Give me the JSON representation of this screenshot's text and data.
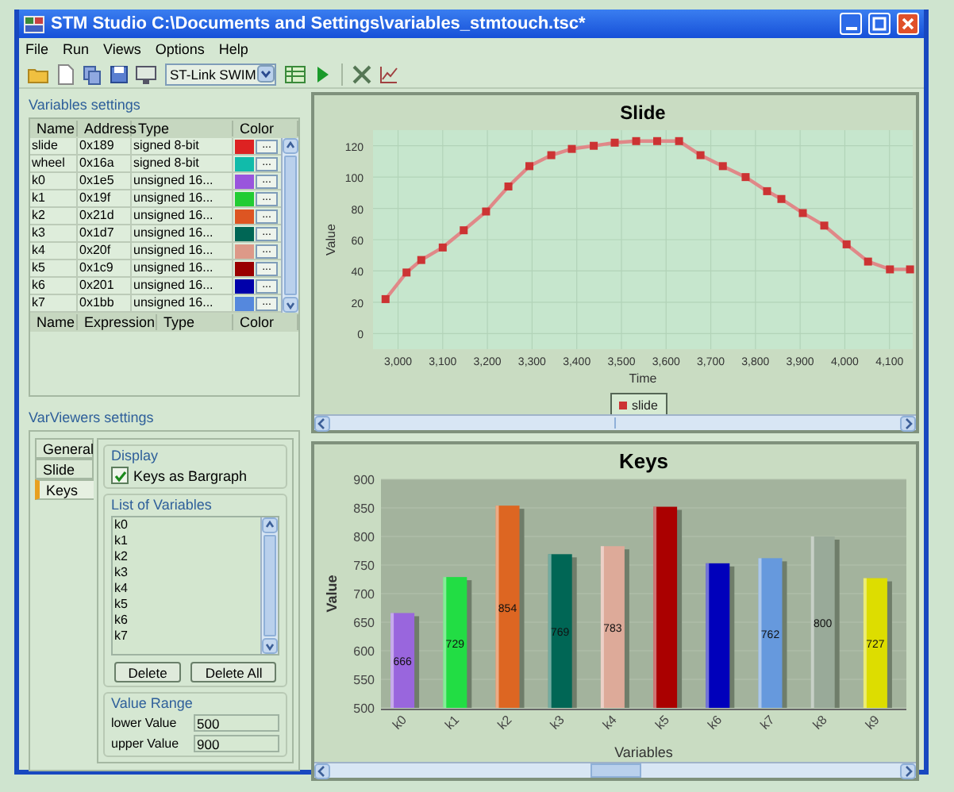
{
  "window": {
    "title": "STM Studio C:\\Documents and Settings\\variables_stmtouch.tsc*"
  },
  "menu": [
    "File",
    "Run",
    "Views",
    "Options",
    "Help"
  ],
  "toolbar": {
    "connection": "ST-Link SWIM"
  },
  "variables_settings": {
    "title": "Variables settings",
    "columns": [
      "Name",
      "Address",
      "Type",
      "Color"
    ],
    "rows": [
      {
        "name": "slide",
        "address": "0x189",
        "type": "signed 8-bit",
        "color": "#dd2222",
        "picker": "..."
      },
      {
        "name": "wheel",
        "address": "0x16a",
        "type": "signed 8-bit",
        "color": "#11bbaa",
        "picker": "..."
      },
      {
        "name": "k0",
        "address": "0x1e5",
        "type": "unsigned 16...",
        "color": "#9955dd",
        "picker": "..."
      },
      {
        "name": "k1",
        "address": "0x19f",
        "type": "unsigned 16...",
        "color": "#22cc33",
        "picker": "..."
      },
      {
        "name": "k2",
        "address": "0x21d",
        "type": "unsigned 16...",
        "color": "#dd5522",
        "picker": "..."
      },
      {
        "name": "k3",
        "address": "0x1d7",
        "type": "unsigned 16...",
        "color": "#006655",
        "picker": "..."
      },
      {
        "name": "k4",
        "address": "0x20f",
        "type": "unsigned 16...",
        "color": "#dd9988",
        "picker": "..."
      },
      {
        "name": "k5",
        "address": "0x1c9",
        "type": "unsigned 16...",
        "color": "#990000",
        "picker": "..."
      },
      {
        "name": "k6",
        "address": "0x201",
        "type": "unsigned 16...",
        "color": "#0000aa",
        "picker": "..."
      },
      {
        "name": "k7",
        "address": "0x1bb",
        "type": "unsigned 16...",
        "color": "#5588dd",
        "picker": "..."
      }
    ],
    "expressions": {
      "columns": [
        "Name",
        "Expression",
        "Type",
        "Color"
      ]
    }
  },
  "viewers_settings": {
    "title": "VarViewers settings",
    "tabs": [
      {
        "label": "General",
        "selected": false
      },
      {
        "label": "Slide",
        "selected": false
      },
      {
        "label": "Keys",
        "selected": true
      }
    ],
    "display": {
      "title": "Display",
      "bargraph": {
        "label": "Keys as Bargraph",
        "checked": true
      }
    },
    "list": {
      "title": "List of Variables",
      "items": [
        "k0",
        "k1",
        "k2",
        "k3",
        "k4",
        "k5",
        "k6",
        "k7"
      ]
    },
    "buttons": [
      "Delete",
      "Delete All"
    ],
    "range": {
      "title": "Value Range",
      "fields": [
        {
          "label": "lower Value",
          "value": "500"
        },
        {
          "label": "upper Value",
          "value": "900"
        }
      ]
    }
  },
  "slide_viewer": {
    "chart_data": {
      "type": "line",
      "title": "Slide",
      "xlabel": "Time",
      "ylabel": "Value",
      "x": [
        2972,
        3019,
        3052,
        3100,
        3147,
        3197,
        3247,
        3294,
        3343,
        3389,
        3438,
        3485,
        3533,
        3580,
        3629,
        3677,
        3727,
        3778,
        3826,
        3858,
        3906,
        3954,
        4004,
        4052,
        4101,
        4146
      ],
      "grid": true,
      "series": [
        {
          "name": "slide",
          "color": "#cc3333",
          "marker": "square",
          "values": [
            22,
            39,
            47,
            55,
            66,
            78,
            94,
            107,
            114,
            118,
            120,
            122,
            123,
            123,
            123,
            114,
            107,
            100,
            91,
            86,
            77,
            69,
            57,
            46,
            41,
            41
          ]
        }
      ],
      "xlim": [
        2944,
        4152
      ],
      "ylim": [
        -10,
        130
      ],
      "xticks": [
        {
          "value": 3000,
          "label": "3,000"
        },
        {
          "value": 3100,
          "label": "3,100"
        },
        {
          "value": 3200,
          "label": "3,200"
        },
        {
          "value": 3300,
          "label": "3,300"
        },
        {
          "value": 3400,
          "label": "3,400"
        },
        {
          "value": 3500,
          "label": "3,500"
        },
        {
          "value": 3600,
          "label": "3,600"
        },
        {
          "value": 3700,
          "label": "3,700"
        },
        {
          "value": 3800,
          "label": "3,800"
        },
        {
          "value": 3900,
          "label": "3,900"
        },
        {
          "value": 4000,
          "label": "4,000"
        },
        {
          "value": 4100,
          "label": "4,100"
        }
      ],
      "yticks": [
        0,
        20,
        40,
        60,
        80,
        100,
        120
      ]
    }
  },
  "keys_viewer": {
    "chart_data": {
      "type": "bar",
      "title": "Keys",
      "xlabel": "Variables",
      "ylabel": "Value",
      "categories": [
        "k0",
        "k1",
        "k2",
        "k3",
        "k4",
        "k5",
        "k6",
        "k7",
        "k8",
        "k9"
      ],
      "grid": true,
      "series": [
        {
          "colors": [
            "#9966dd",
            "#22dd44",
            "#dd6622",
            "#006655",
            "#ddaa99",
            "#aa0000",
            "#0000bb",
            "#6699dd",
            "#99aa99",
            "#dddd00"
          ],
          "values": [
            666,
            729,
            854,
            769,
            783,
            852,
            753,
            762,
            800,
            727
          ]
        }
      ],
      "value_labels": [
        "666",
        "729",
        "854",
        "769",
        "783",
        null,
        null,
        "762",
        "800",
        "727"
      ],
      "ylim": [
        500,
        900
      ],
      "yticks": [
        500,
        550,
        600,
        650,
        700,
        750,
        800,
        850,
        900
      ]
    }
  }
}
